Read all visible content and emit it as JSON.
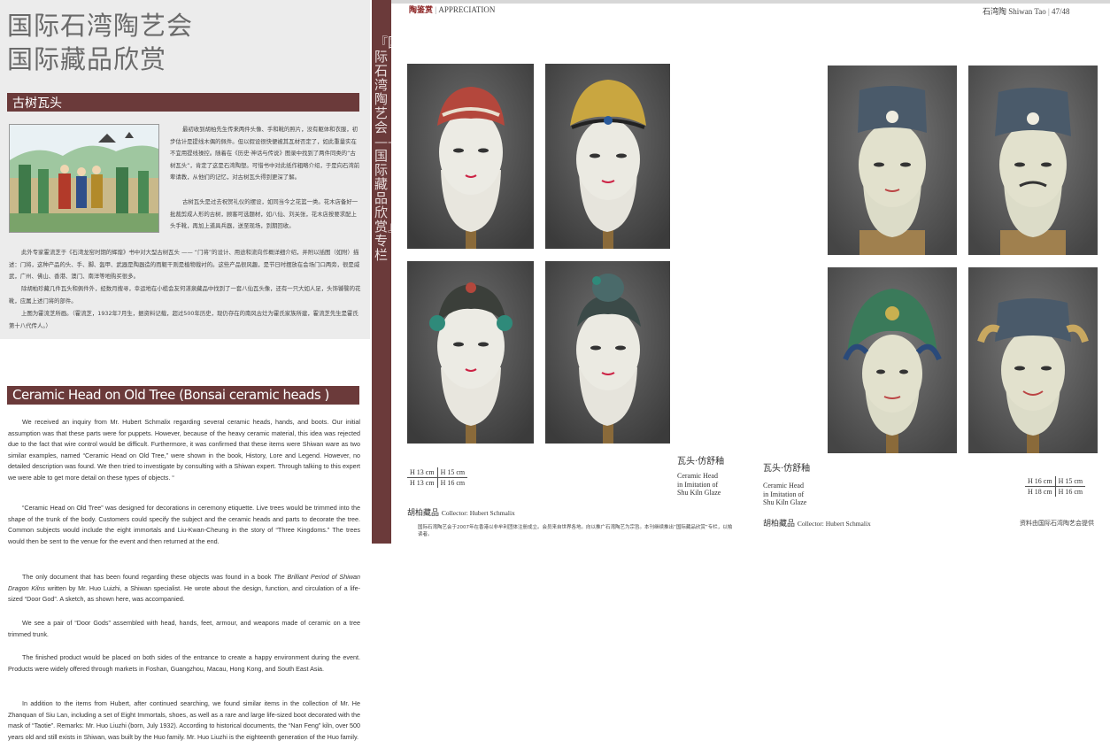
{
  "left": {
    "title_line1": "国际石湾陶艺会",
    "title_line2": "国际藏品欣赏",
    "section_zh": "古树瓦头",
    "zh_side_1": "最初收到胡柏先生传来两件头像、手和靴的照片，没有躯体和衣服，初步估计是提线木偶的佩件。但以假设很快便被其瓦材否定了，如此重量实在不宜用提线操控。随着在《历史·神话与传说》图录中找到了两件同类的“古树瓦头”，肯定了这是石湾陶塑。可惜书中对此纸作粗略介绍，于是向石湾前辈请教，从他们的记忆，对古树瓦头得到更深了解。",
    "zh_side_2": "古树瓦头是过去祝贺礼仪的摆设，如同当今之花篮一类。花木店备好一批裁剪成人形的古树，顾客可选题材，如八仙、刘关张，花木店按要求配上头手靴，再加上道具兵器，送至现场，到期回收。",
    "zh_full_1": "此外专家霍流芝于《石湾龙窑时期的辉煌》书中对大型古树瓦头 —— “门将”的设计、用途和流向作概详细介绍，并附以插图（如附）描述：门将，这种产品的头、手、脚、盔甲、武器是陶器造的而躯干则是植物裁衬的。这些产品很风趣，是节日时摆放在会场门口两旁，很是威武，广州、佛山、香港、澳门、南洋等地购买很多。",
    "zh_full_2": "除胡柏珍藏几件瓦头和佩件外，经数月搜寻，幸运地在小榄会友何湛泉藏品中找到了一套八仙瓦头像，还有一只大如人足，头饰饕餮的花靴，应属上述门将的部件。",
    "zh_full_3": "上图为霍流芝所画。（霍流芝，1932年7月生，据资料记载，超过500年历史，现仍存在的南风古灶为霍氏家族所建，霍流芝先生是霍氏第十八代传人。）",
    "section_en": "Ceramic Head on Old Tree (Bonsai ceramic heads )",
    "en_p1": "We received an inquiry from Mr. Hubert Schmalix regarding several ceramic heads, hands, and boots. Our initial assumption was that these parts were for puppets. However, because of the heavy ceramic material, this idea was rejected due to the fact that wire control would be difficult. Furthermore, it was confirmed that these items were Shiwan ware as two similar examples, named “Ceramic Head on Old Tree,” were shown in the book, History, Lore and Legend. However, no detailed description was found. We then tried to investigate by consulting with a Shiwan expert. Through talking to this expert we were able to get more detail on these types of objects. “",
    "en_p2": "“Ceramic Head on Old Tree” was designed for decorations in ceremony etiquette. Live trees would be trimmed into the shape of the trunk of the body. Customers could specify the subject and the ceramic heads and parts to decorate the tree. Common subjects would include the eight immortals and Liu-Kwan-Cheung in the story of “Three Kingdoms.” The trees would then be sent to the venue for the event and then returned at the end.",
    "en_p3a": "The only document that has been found regarding these objects was found in a book ",
    "en_p3_book": "The Brilliant Period of Shiwan Dragon Kilns",
    "en_p3b": " written by Mr. Huo Luizhi, a Shiwan specialist. He wrote about the design, function, and circulation of a life-sized “Door God”. A sketch, as shown here, was accompanied.",
    "en_p4": "We see a pair of “Door Gods” assembled with head, hands, feet, armour, and weapons made of ceramic on a tree trimmed trunk.",
    "en_p5": "The finished product would be placed on both sides of the entrance to create a happy environment during the event. Products were widely offered through markets in Foshan, Guangzhou, Macau, Hong Kong, and South East Asia.",
    "en_p6": "In addition to the items from Hubert, after continued searching, we found similar items in the collection of Mr. He Zhanquan of Siu Lan, including a set of Eight Immortals, shoes, as well as a rare and large life-sized boot decorated with the mask of “Taotie”. Remarks: Mr. Huo Liuzhi (born, July 1932). According to historical documents, the “Nan Feng” kiln, over 500 years old and still exists in Shiwan, was built by the Huo family. Mr. Huo Liuzhi is the eighteenth generation of the Huo family."
  },
  "spine": {
    "text": "『国际石湾陶艺会——国际藏品欣赏』专栏"
  },
  "spread": {
    "header_left_zh": "陶鉴赏",
    "header_left_en": "APPRECIATION",
    "header_right": "石湾陶 Shiwan Tao",
    "page_num": "47/48",
    "left_page": {
      "caption_zh": "瓦头·仿舒釉",
      "caption_en": [
        "Ceramic Head",
        "in Imitation of",
        "Shu Kiln Glaze"
      ],
      "sizes": [
        [
          "H 13 cm",
          "H 15 cm"
        ],
        [
          "H 13 cm",
          "H 16 cm"
        ]
      ],
      "collector_zh": "胡柏藏品",
      "collector_en": "Collector: Hubert Schmalix",
      "note": "国际石湾陶艺会于2007年在香港以非牟利团体注册成立。会员来自世界各地。向以推广石湾陶艺为宗旨。本刊继续推出“国际藏品欣赏”专栏，以飨读者。"
    },
    "right_page": {
      "caption_zh": "瓦头·仿舒釉",
      "caption_en": [
        "Ceramic Head",
        "in Imitation of",
        "Shu Kiln Glaze"
      ],
      "sizes": [
        [
          "H 16 cm",
          "H 15 cm"
        ],
        [
          "H 18 cm",
          "H 16 cm"
        ]
      ],
      "collector_zh": "胡柏藏品",
      "collector_en": "Collector: Hubert Schmalix",
      "credit": "资料由国际石湾陶艺会提供"
    }
  }
}
